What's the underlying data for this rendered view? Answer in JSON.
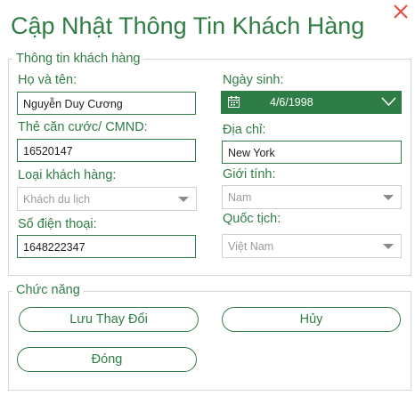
{
  "window": {
    "title": "Cập Nhật Thông Tin Khách Hàng"
  },
  "customer_info": {
    "legend": "Thông tin khách hàng",
    "name": {
      "label": "Họ và tên:",
      "value": "Nguyễn Duy Cương"
    },
    "birthdate": {
      "label": "Ngày sinh:",
      "value": "4/6/1998"
    },
    "id_card": {
      "label": "Thẻ căn cước/ CMND:",
      "value": "16520147"
    },
    "address": {
      "label": "Địa chỉ:",
      "value": "New York"
    },
    "customer_type": {
      "label": "Loại khách hàng:",
      "value": "Khách du lịch"
    },
    "gender": {
      "label": "Giới tính:",
      "value": "Nam"
    },
    "phone": {
      "label": "Số điện thoại:",
      "value": "1648222347"
    },
    "nationality": {
      "label": "Quốc tịch:",
      "value": "Việt Nam"
    }
  },
  "functions": {
    "legend": "Chức năng",
    "save_label": "Lưu Thay Đổi",
    "cancel_label": "Hủy",
    "close_label": "Đóng"
  },
  "colors": {
    "accent": "#2f7d45",
    "date_bg": "#2e7d46",
    "close_icon": "#e74c3c"
  }
}
